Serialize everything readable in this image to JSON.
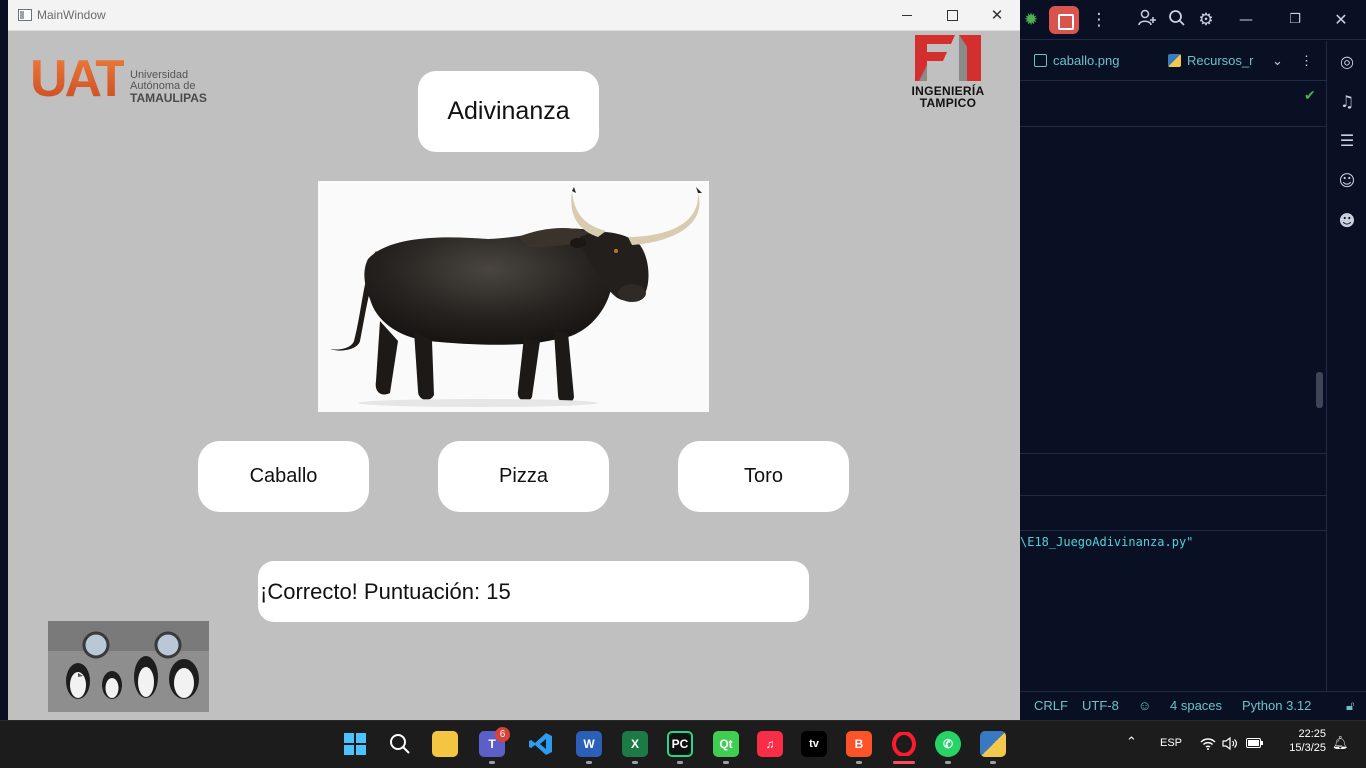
{
  "window": {
    "title": "MainWindow",
    "minimize_label": "",
    "maximize_label": "",
    "close_label": "✕"
  },
  "logos": {
    "uat": {
      "letters": "UAT",
      "line1": "Universidad",
      "line2": "Autónoma de",
      "line3": "TAMAULIPAS"
    },
    "fi": {
      "line1": "INGENIERÍA",
      "line2": "TAMPICO"
    }
  },
  "game": {
    "title": "Adivinanza",
    "image_alt": "toro",
    "options": [
      "Caballo",
      "Pizza",
      "Toro"
    ],
    "result": "¡Correcto! Puntuación: 15",
    "thumbnail_alt": "pingüinos"
  },
  "ide": {
    "tabs": [
      {
        "label": "caballo.png",
        "icon": "image-file-icon"
      },
      {
        "label": "Recursos_r",
        "icon": "python-file-icon"
      }
    ],
    "terminal_line": "\\E18_JuegoAdivinanza.py\"",
    "status": {
      "line_ending": "CRLF",
      "encoding": "UTF-8",
      "indent": "4 spaces",
      "interpreter": "Python 3.12"
    }
  },
  "taskbar": {
    "apps": [
      "start-icon",
      "search-icon",
      "file-explorer-icon",
      "teams-icon",
      "vscode-icon",
      "word-icon",
      "excel-icon",
      "pycharm-icon",
      "qt-designer-icon",
      "apple-music-icon",
      "apple-tv-icon",
      "brave-icon",
      "opera-icon",
      "whatsapp-icon",
      "python-icon"
    ],
    "teams_badge": "6",
    "language": "ESP",
    "time": "22:25",
    "date": "15/3/25"
  },
  "colors": {
    "window_bg": "#c0c0c0",
    "ide_bg": "#0a1024",
    "ide_text": "#6ec0c7",
    "uat_orange": "#e06a32",
    "fi_red": "#d32f2f"
  }
}
